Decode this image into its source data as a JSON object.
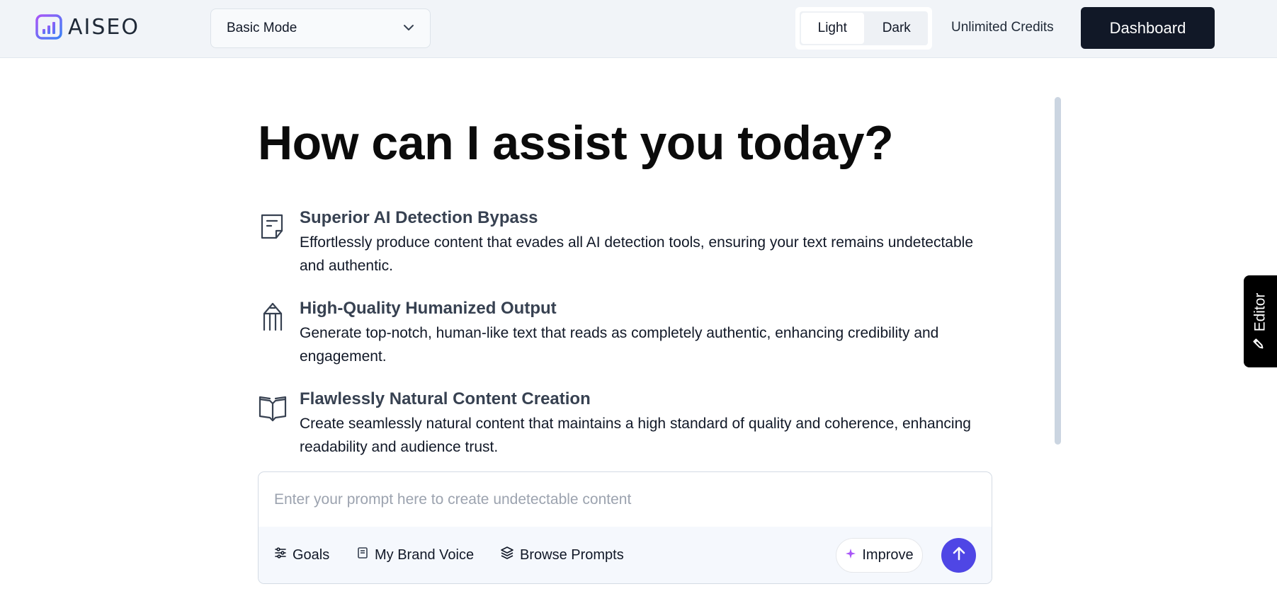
{
  "header": {
    "logo_text": "AISEO",
    "mode_select": {
      "value": "Basic Mode",
      "icon": "chevron-down-icon"
    },
    "theme_toggle": {
      "light_label": "Light",
      "dark_label": "Dark",
      "selected": "Light"
    },
    "credits_label": "Unlimited Credits",
    "dashboard_label": "Dashboard"
  },
  "main": {
    "title": "How can I assist you today?",
    "features": [
      {
        "icon": "document-icon",
        "title": "Superior AI Detection Bypass",
        "description": "Effortlessly produce content that evades all AI detection tools, ensuring your text remains undetectable and authentic."
      },
      {
        "icon": "pencil-tip-icon",
        "title": "High-Quality Humanized Output",
        "description": "Generate top-notch, human-like text that reads as completely authentic, enhancing credibility and engagement."
      },
      {
        "icon": "open-book-icon",
        "title": "Flawlessly Natural Content Creation",
        "description": "Create seamlessly natural content that maintains a high standard of quality and coherence, enhancing readability and audience trust."
      }
    ]
  },
  "editor_tab": {
    "label": "Editor",
    "icon": "pencil-icon"
  },
  "prompt": {
    "placeholder": "Enter your prompt here to create undetectable content",
    "value": "",
    "goals_label": "Goals",
    "brand_voice_label": "My Brand Voice",
    "browse_prompts_label": "Browse Prompts",
    "improve_label": "Improve",
    "send_icon": "arrow-up-icon"
  },
  "colors": {
    "header_bg": "#f1f4f8",
    "dashboard_bg": "#111827",
    "send_bg": "#4f46e5",
    "editor_bg": "#000000"
  }
}
